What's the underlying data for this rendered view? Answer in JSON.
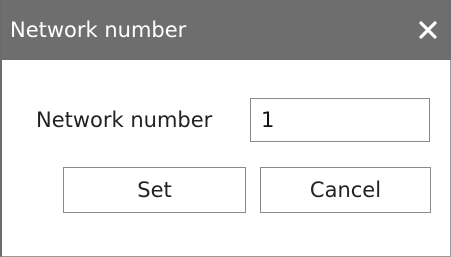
{
  "window": {
    "title": "Network number",
    "close_icon": "close-icon"
  },
  "form": {
    "network_number_label": "Network number",
    "network_number_value": "1"
  },
  "buttons": {
    "set_label": "Set",
    "cancel_label": "Cancel"
  },
  "colors": {
    "titlebar": "#6e6e6e",
    "title_text": "#ffffff",
    "border": "#8a8a8a"
  }
}
